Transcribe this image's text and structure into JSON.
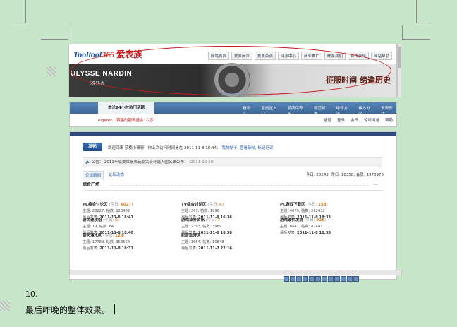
{
  "header": {
    "logo_text": "Tooltool",
    "logo_num": "365",
    "logo_cn": "爱表族",
    "nav": [
      "网站首页",
      "爱表简介",
      "爱表杂谈",
      "评测中心",
      "商业推广",
      "联系我们",
      "合作伙伴",
      "网站帮助"
    ],
    "brand": "ULYSSE NARDIN",
    "brand_cn": "雅典表",
    "slogan": "征服时间 缔造历史"
  },
  "hotbar": {
    "label": "本论24小时热门话题",
    "nav": [
      "精华区",
      "原创区入口",
      "品牌保养板",
      "规范标准",
      "维修方法",
      "维方分会",
      "爱表乐活"
    ],
    "hot_text": "eigarek：首届的腕表盛会“六芯”",
    "links": [
      "话题",
      "登录",
      "会员",
      "论坛问卷",
      "帮助"
    ]
  },
  "forum": {
    "post_button": "发帖",
    "welcome": "欢迎回来 莎楠小哥哥，你上次访问时间是在 2011-11-8 18:44。",
    "welcome_links": [
      "我的帖子",
      "查看新帖",
      "标记已读"
    ],
    "notice_label": "公告：",
    "notice_text": "2011年底爱炫腕表玩家大会评选入围名单公布！",
    "notice_date": "(2011-10-20)",
    "tabs": [
      "论坛新闻",
      "论坛动态"
    ],
    "stats": "今日: 20243, 昨日: 18358, 会员: 1978975",
    "section_title": "综合广场",
    "boards": [
      {
        "name": "PC综合讨论区",
        "today": "6027",
        "topics": "主题: 28227, 帖数: 123482",
        "last": "2011-11-8 18:41"
      },
      {
        "name": "TV综合讨论区",
        "today": "4",
        "topics": "主题: 361, 帖数: 1998",
        "last": "2011-11-8 16:36"
      },
      {
        "name": "PC游戏下载区",
        "today": "158",
        "topics": "主题: 4079, 帖数: 262432",
        "last": "2011-11-8 18:33"
      },
      {
        "name": "游民速攻组",
        "today": "5",
        "topics": "主题: 19, 帖数: 64",
        "last": "2011-11-8 18:40"
      },
      {
        "name": "游戏业界资讯",
        "today": "7",
        "topics": "主题: 2393, 帖数: 3969",
        "last": "2011-11-8 18:38"
      },
      {
        "name": "游戏硬件发烧",
        "today": "926",
        "topics": "主题: 6647, 帖数: 42441",
        "last": "2011-11-8 18:38"
      },
      {
        "name": "聊天灌水区",
        "today": "128",
        "topics": "主题: 17789, 帖数: 353524",
        "last": "2011-11-8 18:37"
      },
      {
        "name": "影音动漫区",
        "today": null,
        "topics": "主题: 1654, 帖数: 10848",
        "last": "2011-11-7 22:16"
      }
    ],
    "today_prefix": "(今日: ",
    "today_suffix": ")",
    "last_prefix": "最后发表: "
  },
  "caption": {
    "number": "10.",
    "text": "最后昨晚的整体效果。"
  },
  "colors": {
    "page_bg": "#c7e5c9",
    "hotbar_blue": "#4a78a9",
    "accent_orange": "#e07a1a",
    "ring_red": "#c21a1a"
  }
}
